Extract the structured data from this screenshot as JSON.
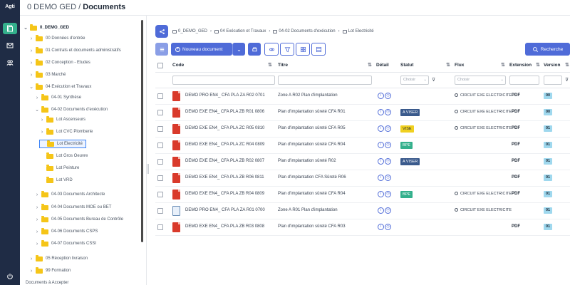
{
  "app": {
    "logo": "Agti"
  },
  "header": {
    "prefix": "0 DEMO GED /",
    "title": "Documents"
  },
  "rail": {
    "items": [
      "documents-icon",
      "mail-icon",
      "users-icon",
      "logout-icon"
    ]
  },
  "tree": {
    "root": "0_DEMO_GED",
    "items": [
      "00 Données d'entrée",
      "01 Contrats et documents administratifs",
      "02 Conception - Etudes",
      "03 Marché",
      "04 Exécution et Travaux",
      "04-01 Synthèse",
      "04-02 Documents d'exécution",
      "Lot Ascenseurs",
      "Lot CVC Plomberie",
      "Lot Electricité",
      "Lot Gros Oeuvre",
      "Lot Peinture",
      "Lot VRD",
      "04-03 Documents Architecte",
      "04-04 Documents MOE ou BET",
      "04-05 Documents Bureau de Contrôle",
      "04-06 Documents CSPS",
      "04-07 Documents CSSI",
      "05 Réception livraison",
      "99 Formation"
    ],
    "bottom": "Documents à Accepter"
  },
  "breadcrumb": [
    "0_DEMO_GED",
    "04 Exécution et Travaux",
    "04-02 Documents d'exécution",
    "Lot Electricité"
  ],
  "toolbar": {
    "new_doc": "Nouveau document",
    "search": "Recherche"
  },
  "grid": {
    "headers": {
      "code": "Code",
      "title": "Titre",
      "detail": "Détail",
      "status": "Statut",
      "flux": "Flux",
      "extension": "Extension",
      "version": "Version"
    },
    "filter_placeholder": "Choisir",
    "rows": [
      {
        "icon": "pdf",
        "code": "DEMO PRO EN4_ CFA PLA ZA R02 0701",
        "title": "Zone A R02 Plan d'implantation",
        "status": "",
        "status_color": "",
        "flux": "CIRCUIT EXE ELECTRICITE",
        "ext": "PDF",
        "version": "00"
      },
      {
        "icon": "pdf",
        "code": "DEMO EXE EN4_ CFA PLA ZB R01 0806",
        "title": "Plan d'implantation sûreté CFA R01",
        "status": "A VISER",
        "status_color": "#3a5a8c",
        "flux": "CIRCUIT EXE ELECTRICITE",
        "ext": "PDF",
        "version": "00"
      },
      {
        "icon": "pdf",
        "code": "DEMO EXE EN4_ CFA PLA ZC R05 0810",
        "title": "Plan d'implantation sûreté CFA R05",
        "status": "VISE",
        "status_color": "#f0d020",
        "flux": "CIRCUIT EXE ELECTRICITE",
        "ext": "PDF",
        "version": "01"
      },
      {
        "icon": "pdf",
        "code": "DEMO EXE EN4_ CFA PLA ZC R04 0809",
        "title": "Plan d'implantation sûreté CFA R04",
        "status": "BPE",
        "status_color": "#34b08c",
        "flux": "",
        "ext": "PDF",
        "version": "01"
      },
      {
        "icon": "pdf",
        "code": "DEMO EXE EN4_ CFA PLA ZB R02 0807",
        "title": "Plan d'implantation sûreté R02",
        "status": "A VISER",
        "status_color": "#3a5a8c",
        "flux": "",
        "ext": "PDF",
        "version": "01"
      },
      {
        "icon": "pdf",
        "code": "DEMO EXE EN4_ CFA PLA ZB R06 0811",
        "title": "Plan d'implantation CFA Sûreté R06",
        "status": "",
        "status_color": "",
        "flux": "",
        "ext": "PDF",
        "version": "01"
      },
      {
        "icon": "pdf",
        "code": "DEMO EXE EN4_ CFA PLA ZB R04 0809",
        "title": "Plan d'implantation sûreté CFA R04",
        "status": "BPE",
        "status_color": "#34b08c",
        "flux": "CIRCUIT EXE ELECTRICITE",
        "ext": "PDF",
        "version": "01"
      },
      {
        "icon": "doc",
        "code": "DEMO PRO EN4_ CFA PLA ZA R01 0700",
        "title": "Zone A R01 Plan d'implantation",
        "status": "",
        "status_color": "",
        "flux": "CIRCUIT EXE ELECTRICITE",
        "ext": "",
        "version": "01"
      },
      {
        "icon": "pdf",
        "code": "DEMO EXE EN4_ CFA PLA ZB R03 0808",
        "title": "Plan d'implantation sûreté CFA R03",
        "status": "",
        "status_color": "",
        "flux": "",
        "ext": "PDF",
        "version": "01"
      }
    ]
  },
  "colors": {
    "rail": "#1f2c45",
    "accent": "#4f6bd8",
    "active": "#34b08c"
  }
}
